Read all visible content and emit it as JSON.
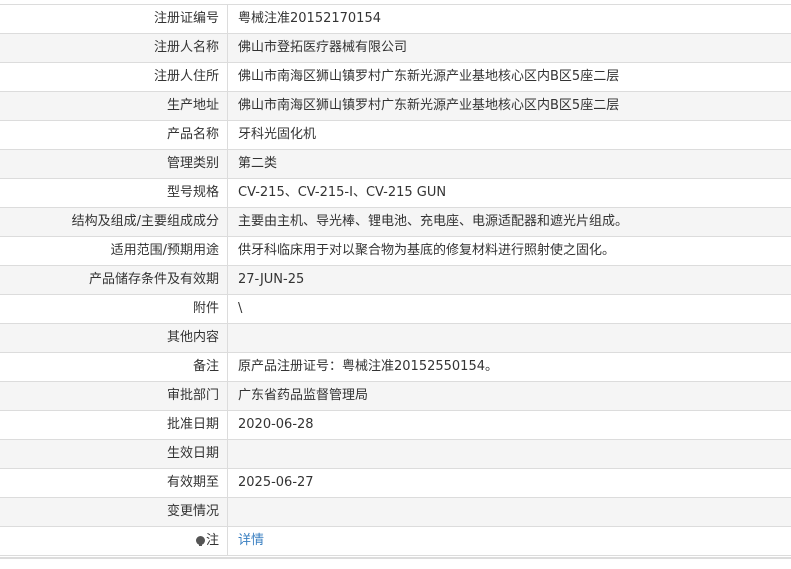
{
  "rows": [
    {
      "label": "注册证编号",
      "value": "粤械注准20152170154"
    },
    {
      "label": "注册人名称",
      "value": "佛山市登拓医疗器械有限公司"
    },
    {
      "label": "注册人住所",
      "value": "佛山市南海区狮山镇罗村广东新光源产业基地核心区内B区5座二层"
    },
    {
      "label": "生产地址",
      "value": "佛山市南海区狮山镇罗村广东新光源产业基地核心区内B区5座二层"
    },
    {
      "label": "产品名称",
      "value": "牙科光固化机"
    },
    {
      "label": "管理类别",
      "value": "第二类"
    },
    {
      "label": "型号规格",
      "value": "CV-215、CV-215-I、CV-215 GUN"
    },
    {
      "label": "结构及组成/主要组成成分",
      "value": "主要由主机、导光棒、锂电池、充电座、电源适配器和遮光片组成。"
    },
    {
      "label": "适用范围/预期用途",
      "value": "供牙科临床用于对以聚合物为基底的修复材料进行照射使之固化。"
    },
    {
      "label": "产品储存条件及有效期",
      "value": "27-JUN-25"
    },
    {
      "label": "附件",
      "value": "\\"
    },
    {
      "label": "其他内容",
      "value": ""
    },
    {
      "label": "备注",
      "value": "原产品注册证号：粤械注准20152550154。"
    },
    {
      "label": "审批部门",
      "value": "广东省药品监督管理局"
    },
    {
      "label": "批准日期",
      "value": "2020-06-28"
    },
    {
      "label": "生效日期",
      "value": ""
    },
    {
      "label": "有效期至",
      "value": "2025-06-27"
    },
    {
      "label": "变更情况",
      "value": ""
    }
  ],
  "note_row": {
    "icon": "pin-icon",
    "label": "注",
    "link_text": "详情"
  }
}
